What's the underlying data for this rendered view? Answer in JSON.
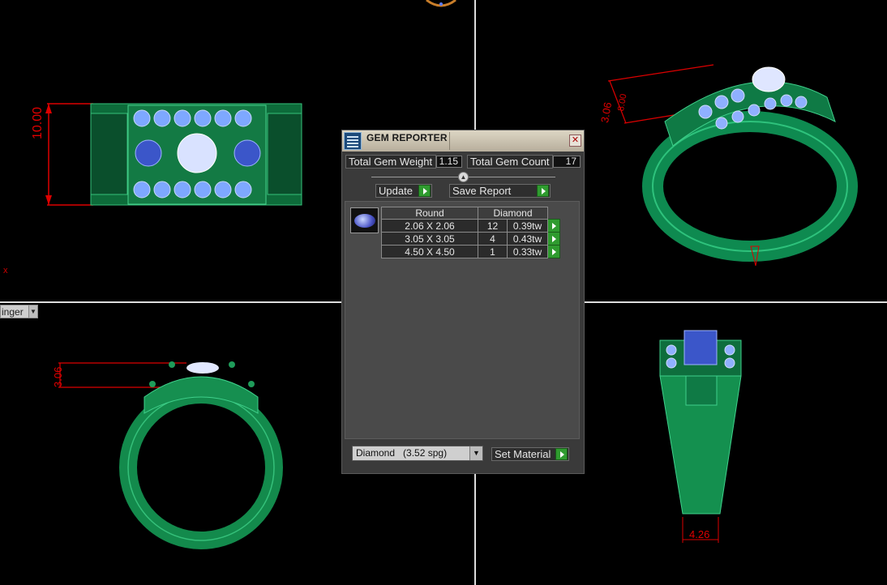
{
  "viewport": {
    "dims": [
      "10.00",
      "3.06",
      "8.00",
      "3.06",
      "4.26"
    ],
    "view_dropdown": "inger",
    "axis_label": "x"
  },
  "panel": {
    "title": "GEM REPORTER",
    "total_gem_weight_label": "Total Gem Weight",
    "total_gem_weight_value": "1.15",
    "total_gem_count_label": "Total Gem Count",
    "total_gem_count_value": "17",
    "update_label": "Update",
    "save_report_label": "Save Report",
    "table": {
      "headers": [
        "Round",
        "Diamond"
      ],
      "rows": [
        {
          "size": "2.06 X 2.06",
          "count": "12",
          "weight": "0.39tw"
        },
        {
          "size": "3.05 X 3.05",
          "count": "4",
          "weight": "0.43tw"
        },
        {
          "size": "4.50 X 4.50",
          "count": "1",
          "weight": "0.33tw"
        }
      ]
    },
    "material": "Diamond",
    "material_spg": "(3.52 spg)",
    "set_material_label": "Set Material"
  }
}
